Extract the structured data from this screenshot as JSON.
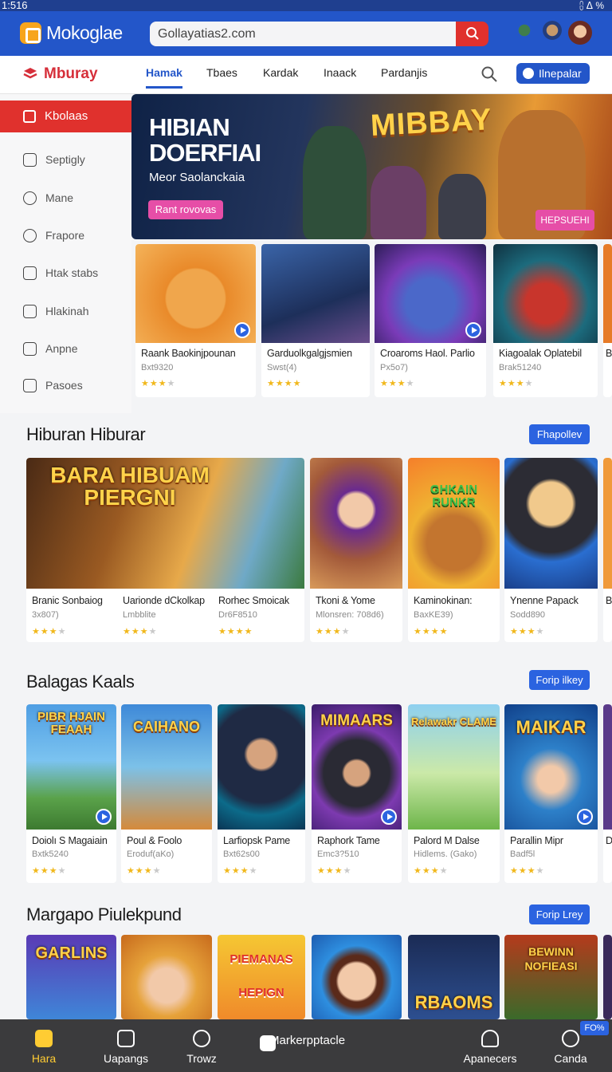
{
  "status": {
    "time": "1:516",
    "right": "⩉ ᐃ %"
  },
  "app": {
    "title": "Mokoglae"
  },
  "search": {
    "url": "Gollayatias2.com"
  },
  "nav": {
    "brand": "Mburay",
    "tabs": [
      "Hamak",
      "Tbaes",
      "Kardak",
      "Inaack",
      "Pardanjis"
    ],
    "button": "Ilnepalar"
  },
  "sidebar": {
    "active": "Kbolaas",
    "items": [
      "Septigly",
      "Mane",
      "Frapore",
      "Htak stabs",
      "Hlakinah",
      "Anpne",
      "Pasoes"
    ]
  },
  "hero": {
    "title": "HIBIAN DOERFIAI",
    "subtitle": "Meor Saolanckaia",
    "button": "Rant rovovas",
    "logo": "MIBBAY",
    "badge": "HEPSUEHI"
  },
  "featured": [
    {
      "title": "Raank Baokinjpounan",
      "meta": "Bxt9320",
      "rating": 3
    },
    {
      "title": "Garduolkgalgjsmien",
      "meta": "Swst(4)",
      "rating": 4
    },
    {
      "title": "Croaroms Haol. Parlio",
      "meta": "Px5o7)",
      "rating": 3
    },
    {
      "title": "Kiagoalak Oplatebil",
      "meta": "Brak51240",
      "rating": 3
    },
    {
      "title": "B",
      "meta": "B",
      "rating": 0
    }
  ],
  "sections": [
    {
      "title": "Hiburan Hiburar",
      "button": "Fhapollev",
      "cover": "BARA HIBUAM PIERGNI",
      "cards": [
        {
          "title": "Branic Sonbaiog",
          "meta": "3x807)",
          "rating": 3
        },
        {
          "title": "Uarionde dCkolkap",
          "meta": "Lmbblite",
          "rating": 3
        },
        {
          "title": "Rorhec Smoicak",
          "meta": "Dr6F8510",
          "rating": 4
        },
        {
          "title": "Tkoni & Yome",
          "meta": "Mlonsren: 708d6)",
          "rating": 3
        },
        {
          "title": "Kaminokinan:",
          "meta": "BaxKE39)",
          "rating": 4
        },
        {
          "title": "Ynenne Papack",
          "meta": "Sodd890",
          "rating": 3
        },
        {
          "title": "B",
          "meta": "B",
          "rating": 0
        }
      ],
      "covers": [
        "",
        "",
        "GHKAIN RUNKR",
        ""
      ]
    },
    {
      "title": "Balagas Kaals",
      "button": "Forip ilkey",
      "cards": [
        {
          "title": "Doiolı S Magaiain",
          "meta": "Bxtk5240",
          "rating": 3,
          "cover": "PIBR HJAIN FEAAH"
        },
        {
          "title": "Poul & Foolo",
          "meta": "Eroduf(aKo)",
          "rating": 3,
          "cover": "CAIHANO"
        },
        {
          "title": "Larfiopsk Pame",
          "meta": "Bxt62s00",
          "rating": 3,
          "cover": ""
        },
        {
          "title": "Raphork Tame",
          "meta": "Emc3?510",
          "rating": 3,
          "cover": "MIMAARS"
        },
        {
          "title": "Palord M Dalse",
          "meta": "Hidlems. (Gako)",
          "rating": 3,
          "cover": "Relawakr CLAME"
        },
        {
          "title": "Parallin Mipr",
          "meta": "Badf5l",
          "rating": 3,
          "cover": "MAIKAR"
        },
        {
          "title": "D",
          "meta": "B",
          "rating": 0,
          "cover": ""
        }
      ]
    },
    {
      "title": "Margapo Piulekpund",
      "button": "Forip Lrey",
      "covers": [
        "GARLINS",
        "",
        "PIEMANAS HEPIGN",
        "",
        "RBAOMS",
        "BEWINN NOFIEASI"
      ]
    }
  ],
  "bottom": {
    "items": [
      "Hara",
      "Uapangs",
      "Trowz",
      "Markerpptacle",
      "Apanecers",
      "Canda"
    ],
    "new_badge": "FO%"
  },
  "colors": {
    "primary": "#2356c9",
    "accent": "#e0312d",
    "pink": "#e64ea7",
    "star": "#f1b81d"
  }
}
